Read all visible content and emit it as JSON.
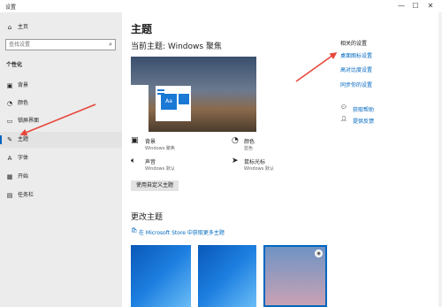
{
  "window": {
    "title": "设置",
    "minimize_glyph": "—",
    "maximize_glyph": "☐",
    "close_glyph": "✕"
  },
  "sidebar": {
    "home": "主页",
    "search_placeholder": "查找设置",
    "section": "个性化",
    "items": [
      {
        "label": "背景",
        "icon": "image-icon"
      },
      {
        "label": "颜色",
        "icon": "palette-icon"
      },
      {
        "label": "锁屏界面",
        "icon": "monitor-icon"
      },
      {
        "label": "主题",
        "icon": "theme-icon",
        "active": true
      },
      {
        "label": "字体",
        "icon": "font-icon"
      },
      {
        "label": "开始",
        "icon": "start-icon"
      },
      {
        "label": "任务栏",
        "icon": "taskbar-icon"
      }
    ]
  },
  "main": {
    "title": "主题",
    "current_theme": "当前主题: Windows 聚焦",
    "preview_tile_text": "Aa",
    "settings": [
      {
        "name": "背景",
        "value": "Windows 聚焦",
        "icon": "image-icon"
      },
      {
        "name": "颜色",
        "value": "蓝色",
        "icon": "palette-icon"
      },
      {
        "name": "声音",
        "value": "Windows 默认",
        "icon": "sound-icon"
      },
      {
        "name": "鼠标光标",
        "value": "Windows 默认",
        "icon": "cursor-icon"
      }
    ],
    "save_button": "使用自定义主题",
    "change_theme": "更改主题",
    "store_link": "在 Microsoft Store 中获取更多主题"
  },
  "related": {
    "title": "相关的设置",
    "links": [
      "桌面图标设置",
      "高对比度设置",
      "同步你的设置"
    ],
    "help": "获取帮助",
    "feedback": "提供反馈"
  },
  "colors": {
    "accent": "#0067c0",
    "sidebar_bg": "#ececec",
    "annotation_arrow": "#e8463a"
  }
}
